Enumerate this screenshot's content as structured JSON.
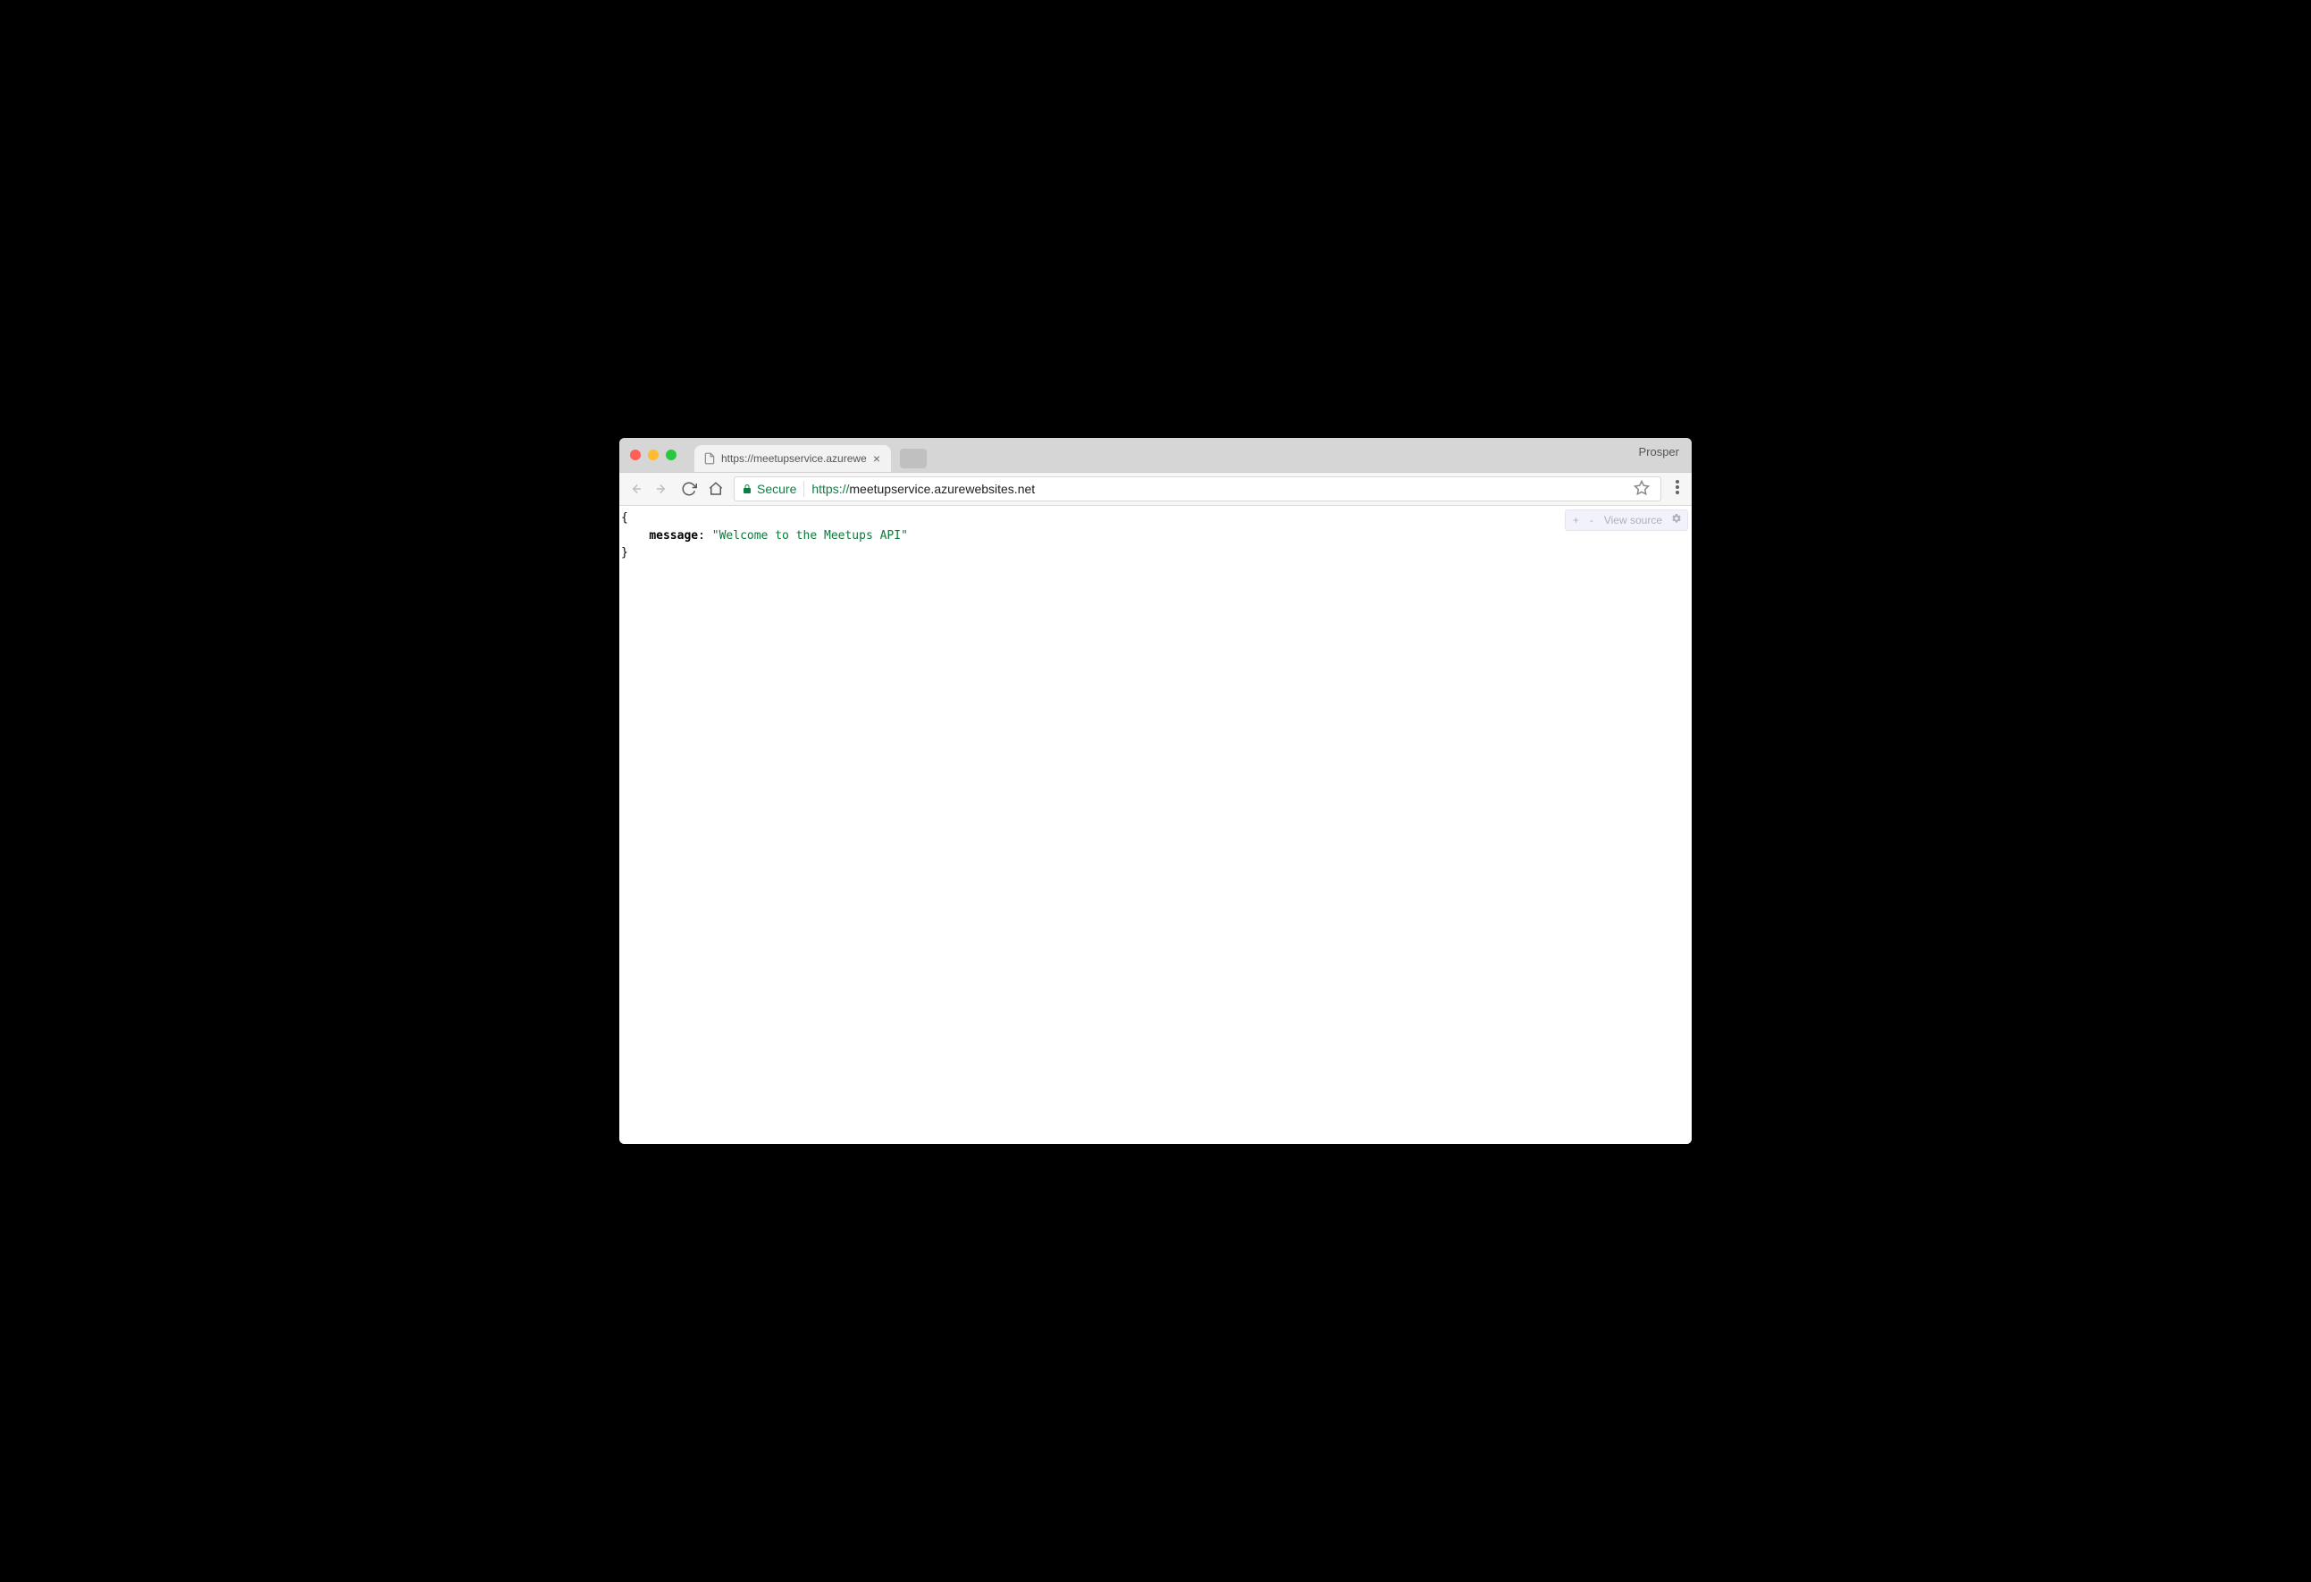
{
  "chrome": {
    "profile_label": "Prosper",
    "tab": {
      "title": "https://meetupservice.azurewe",
      "close_glyph": "×"
    },
    "toolbar": {
      "secure_label": "Secure",
      "url_scheme": "https://",
      "url_host": "meetupservice.azurewebsites.net",
      "url_rest": ""
    }
  },
  "json_viewer": {
    "expand_label": "+",
    "collapse_label": "-",
    "view_source_label": "View source"
  },
  "body": {
    "open_brace": "{",
    "indent": "    ",
    "key": "message",
    "colon": ": ",
    "value": "\"Welcome to the Meetups API\"",
    "close_brace": "}"
  }
}
